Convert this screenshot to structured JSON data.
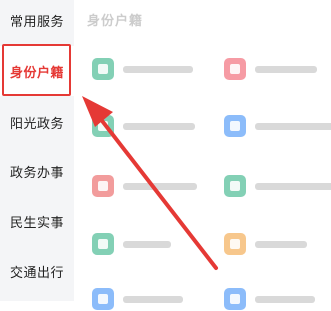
{
  "sidebar": {
    "items": [
      {
        "label": "常用服务"
      },
      {
        "label": "身份户籍"
      },
      {
        "label": "阳光政务"
      },
      {
        "label": "政务办事"
      },
      {
        "label": "民生实事"
      },
      {
        "label": "交通出行"
      }
    ],
    "active_index": 1
  },
  "main": {
    "section_title": "身份户籍"
  },
  "services": [
    {
      "icon": "id-card-icon",
      "color": "#1faa7a"
    },
    {
      "icon": "folder-icon",
      "color": "#f04a5a"
    },
    {
      "icon": "id-card-icon",
      "color": "#1faa7a"
    },
    {
      "icon": "home-icon",
      "color": "#2f86f6"
    },
    {
      "icon": "gift-icon",
      "color": "#e84c4c"
    },
    {
      "icon": "person-icon",
      "color": "#1faa7a"
    },
    {
      "icon": "home-icon",
      "color": "#1faa7a"
    },
    {
      "icon": "document-icon",
      "color": "#f29b2f"
    },
    {
      "icon": "id-card-icon",
      "color": "#2f86f6"
    },
    {
      "icon": "id-card-icon",
      "color": "#2f86f6"
    }
  ],
  "colors": {
    "accent": "#e53935",
    "sidebar_bg": "#f4f5f7"
  }
}
